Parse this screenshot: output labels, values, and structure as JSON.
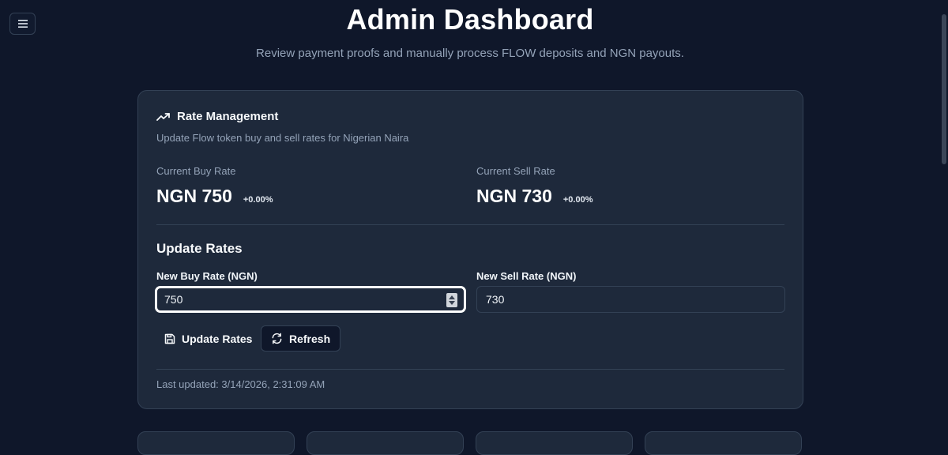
{
  "header": {
    "title": "Admin Dashboard",
    "subtitle": "Review payment proofs and manually process FLOW deposits and NGN payouts."
  },
  "menu": {
    "icon": "hamburger-icon"
  },
  "rate_card": {
    "icon": "trending-up-icon",
    "title": "Rate Management",
    "description": "Update Flow token buy and sell rates for Nigerian Naira",
    "buy": {
      "label": "Current Buy Rate",
      "value": "NGN 750",
      "change": "+0.00%"
    },
    "sell": {
      "label": "Current Sell Rate",
      "value": "NGN 730",
      "change": "+0.00%"
    },
    "update_section": {
      "title": "Update Rates",
      "buy_label": "New Buy Rate (NGN)",
      "buy_value": "750",
      "sell_label": "New Sell Rate (NGN)",
      "sell_value": "730"
    },
    "buttons": {
      "update": {
        "label": "Update Rates",
        "icon": "save-icon"
      },
      "refresh": {
        "label": "Refresh",
        "icon": "refresh-icon"
      }
    },
    "last_updated": "Last updated: 3/14/2026, 2:31:09 AM"
  },
  "colors": {
    "background": "#0f172a",
    "card": "#1e293b",
    "border": "#334155",
    "muted_text": "#94a3b8"
  }
}
